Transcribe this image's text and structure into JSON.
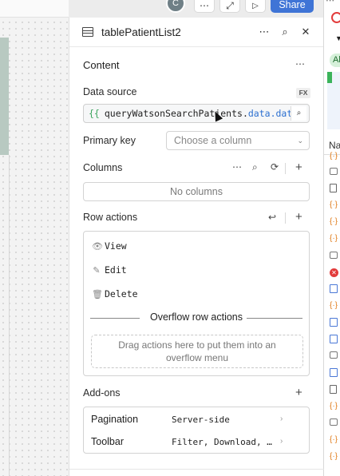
{
  "toolbar": {
    "avatar_letter": "C",
    "more_icon": "more-horizontal-icon",
    "expand_icon": "expand-icon",
    "play_icon": "play-icon",
    "share_label": "Share"
  },
  "panel": {
    "title": "tablePatientList2",
    "content_title": "Content",
    "data_source": {
      "label": "Data source",
      "fx_label": "FX",
      "value_brace": "{{",
      "value_query": "queryWatsonSearchPatients.",
      "value_prop": "data.data"
    },
    "primary_key": {
      "label": "Primary key",
      "placeholder": "Choose a column"
    },
    "columns": {
      "label": "Columns",
      "empty_text": "No columns"
    },
    "row_actions": {
      "label": "Row actions",
      "items": [
        {
          "label": "View",
          "icon": "eye-icon"
        },
        {
          "label": "Edit",
          "icon": "pencil-icon"
        },
        {
          "label": "Delete",
          "icon": "trash-icon"
        }
      ],
      "overflow_label": "Overflow row actions",
      "drop_hint_line1": "Drag actions here to put them into an",
      "drop_hint_line2": "overflow menu"
    },
    "addons": {
      "label": "Add-ons",
      "items": [
        {
          "label": "Pagination",
          "value": "Server-side"
        },
        {
          "label": "Toolbar",
          "value": "Filter, Download, …"
        }
      ]
    }
  },
  "strip": {
    "pill_text": "Al",
    "header_text": "Na"
  },
  "colors": {
    "accent": "#3f74d6",
    "brace": "#3aa35c",
    "prop": "#2b6fd0"
  }
}
